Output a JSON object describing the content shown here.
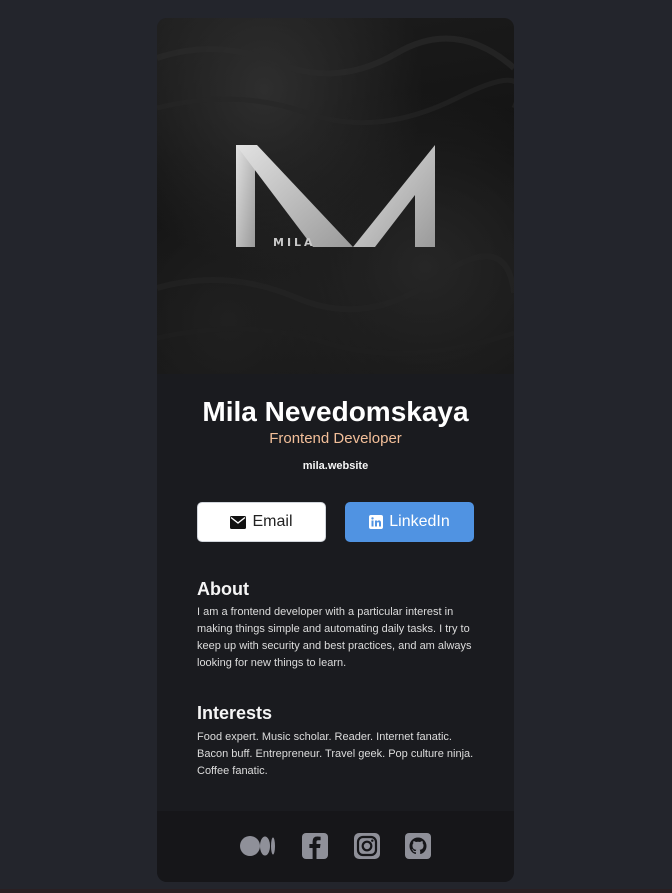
{
  "profile": {
    "name": "Mila Nevedomskaya",
    "role": "Frontend Developer",
    "website": "mila.website",
    "logo_text": "MILA"
  },
  "actions": {
    "email_label": "Email",
    "linkedin_label": "LinkedIn"
  },
  "about": {
    "title": "About",
    "text": "I am a frontend developer with a particular interest in making things simple and automating daily tasks. I try to keep up with security and best practices, and am always looking for new things to learn."
  },
  "interests": {
    "title": "Interests",
    "text": "Food expert. Music scholar. Reader. Internet fanatic. Bacon buff. Entrepreneur. Travel geek. Pop culture ninja. Coffee fanatic."
  },
  "social": [
    {
      "icon": "medium-icon"
    },
    {
      "icon": "facebook-icon"
    },
    {
      "icon": "instagram-icon"
    },
    {
      "icon": "github-icon"
    }
  ],
  "colors": {
    "background": "#23252c",
    "card": "#1a1b1f",
    "accent_role": "#f3bf99",
    "linkedin": "#5093e2",
    "icon": "#8f9099"
  }
}
